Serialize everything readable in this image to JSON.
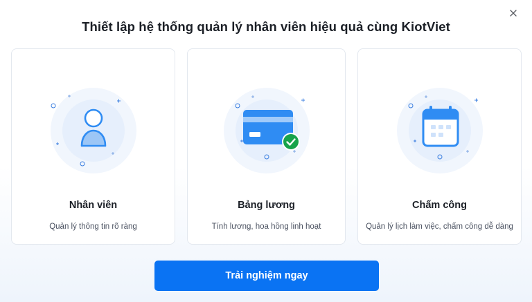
{
  "modal": {
    "title": "Thiết lập hệ thống quản lý nhân viên hiệu quả cùng KiotViet",
    "close_icon": "close-icon"
  },
  "cards": [
    {
      "title": "Nhân viên",
      "description": "Quản lý thông tin rõ ràng",
      "icon": "user-icon"
    },
    {
      "title": "Bảng lương",
      "description": "Tính lương, hoa hồng linh hoạt",
      "icon": "payroll-card-icon"
    },
    {
      "title": "Chấm công",
      "description": "Quản lý lịch làm việc, chấm công dễ dàng",
      "icon": "calendar-icon"
    }
  ],
  "cta": {
    "label": "Trải nghiệm ngay"
  },
  "colors": {
    "primary": "#0a73f3",
    "icon_blue": "#2f8cf3",
    "icon_light": "#9cc6f6",
    "halo": "#e9f2fd",
    "success": "#17a34a"
  }
}
